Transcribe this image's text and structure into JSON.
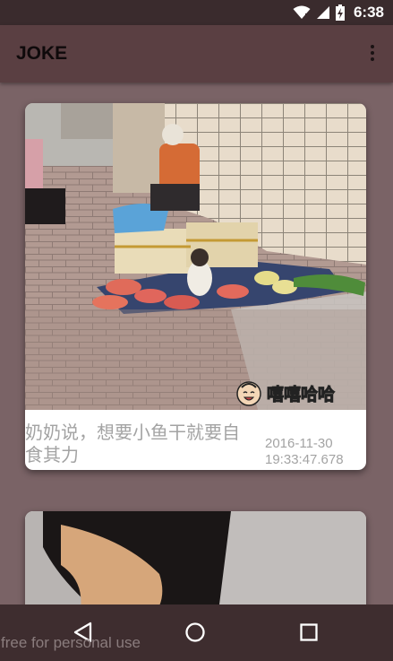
{
  "status_bar": {
    "time": "6:38",
    "icons": [
      "wifi-icon",
      "cell-signal-icon",
      "battery-charging-icon"
    ]
  },
  "app_bar": {
    "title": "JOKE",
    "overflow_icon": "more-vert-icon"
  },
  "feed": {
    "items": [
      {
        "caption": "奶奶说，想要小鱼干就要自食其力",
        "timestamp": "2016-11-30 19:33:47.678",
        "image_watermark": "嘻嘻哈哈"
      },
      {
        "caption": "",
        "timestamp": ""
      }
    ]
  },
  "nav_bar": {
    "buttons": [
      "back-icon",
      "home-icon",
      "recents-icon"
    ]
  },
  "footer_note": "free for personal use",
  "colors": {
    "background": "#7a6366",
    "app_bar": "#5a3f42",
    "status_bar": "#3a2b2d",
    "nav_bar": "#3e2d2f",
    "card": "#ffffff",
    "caption_text": "#a3a3a3"
  }
}
